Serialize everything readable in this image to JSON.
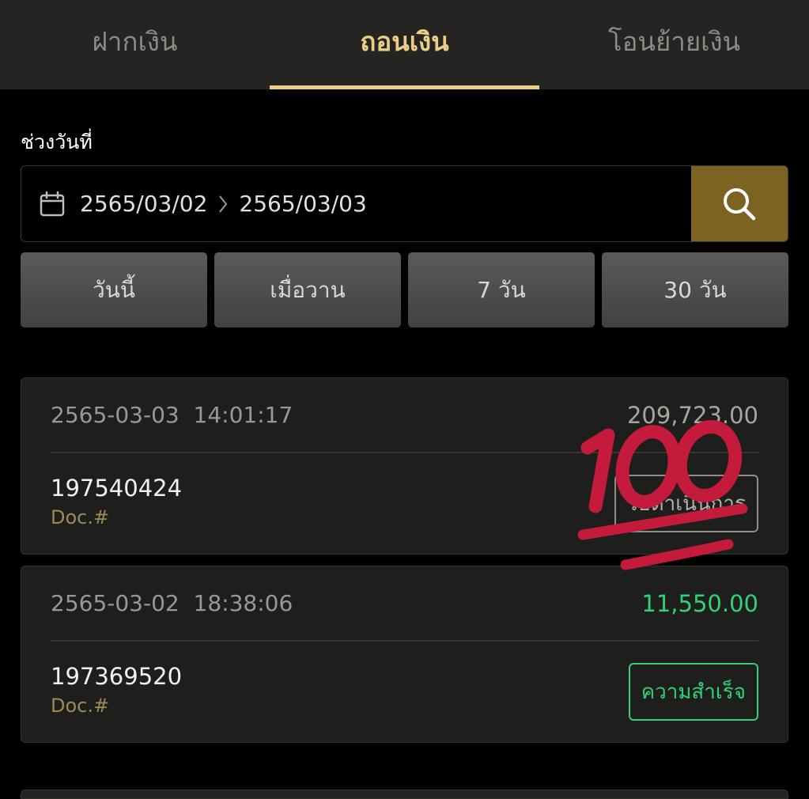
{
  "tabs": [
    {
      "label": "ฝากเงิน",
      "active": false
    },
    {
      "label": "ถอนเงิน",
      "active": true
    },
    {
      "label": "โอนย้ายเงิน",
      "active": false
    }
  ],
  "filter": {
    "range_label": "ช่วงวันที่",
    "start_date": "2565/03/02",
    "end_date": "2565/03/03",
    "quick_ranges": [
      "วันนี้",
      "เมื่อวาน",
      "7 วัน",
      "30 วัน"
    ]
  },
  "transactions": [
    {
      "datetime": "2565-03-03  14:01:17",
      "amount": "209,723.00",
      "doc_no": "197540424",
      "doc_label": "Doc.#",
      "status": "รอดำเนินการ",
      "status_type": "pending"
    },
    {
      "datetime": "2565-03-02  18:38:06",
      "amount": "11,550.00",
      "doc_no": "197369520",
      "doc_label": "Doc.#",
      "status": "ความสำเร็จ",
      "status_type": "success"
    }
  ],
  "colors": {
    "accent": "#e8cf84",
    "search_button": "#7d6322",
    "success": "#2fd277",
    "sticker": "#c41a3b"
  },
  "icons": {
    "calendar": "calendar-icon",
    "chevron": "chevron-right-icon",
    "search": "search-icon",
    "sticker": "hundred-points-emoji"
  }
}
